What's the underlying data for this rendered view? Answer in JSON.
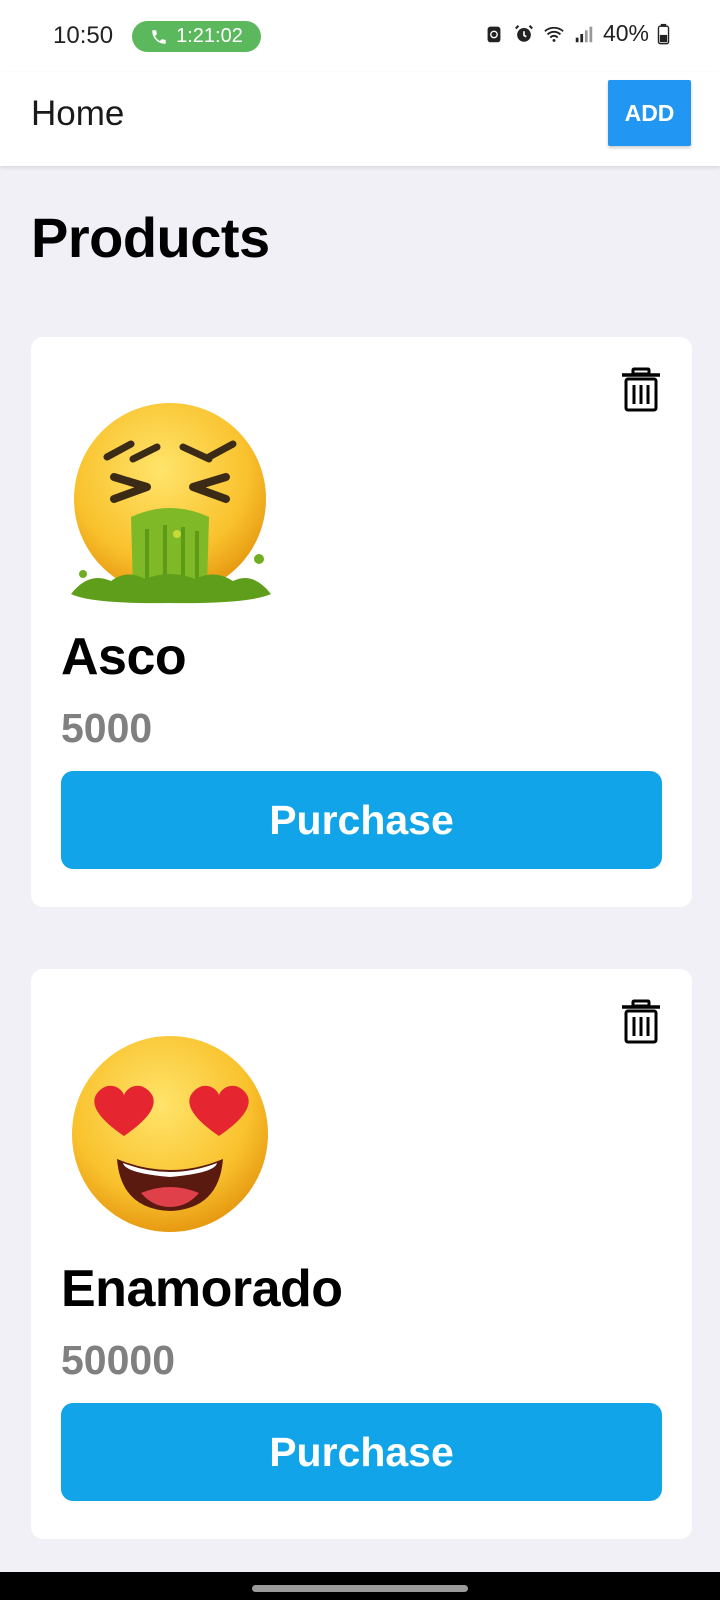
{
  "status_bar": {
    "time": "10:50",
    "call_timer": "1:21:02",
    "battery": "40%"
  },
  "app_bar": {
    "title": "Home",
    "add_label": "ADD"
  },
  "page": {
    "heading": "Products"
  },
  "products": [
    {
      "name": "Asco",
      "price": "5000",
      "emoji": "nauseated-vomiting-face",
      "purchase_label": "Purchase"
    },
    {
      "name": "Enamorado",
      "price": "50000",
      "emoji": "heart-eyes-face",
      "purchase_label": "Purchase"
    }
  ],
  "colors": {
    "accent": "#2196f3",
    "purchase": "#12a4e8",
    "price_text": "#808080",
    "call_pill": "#5cb85c",
    "background": "#f1f0f6"
  }
}
